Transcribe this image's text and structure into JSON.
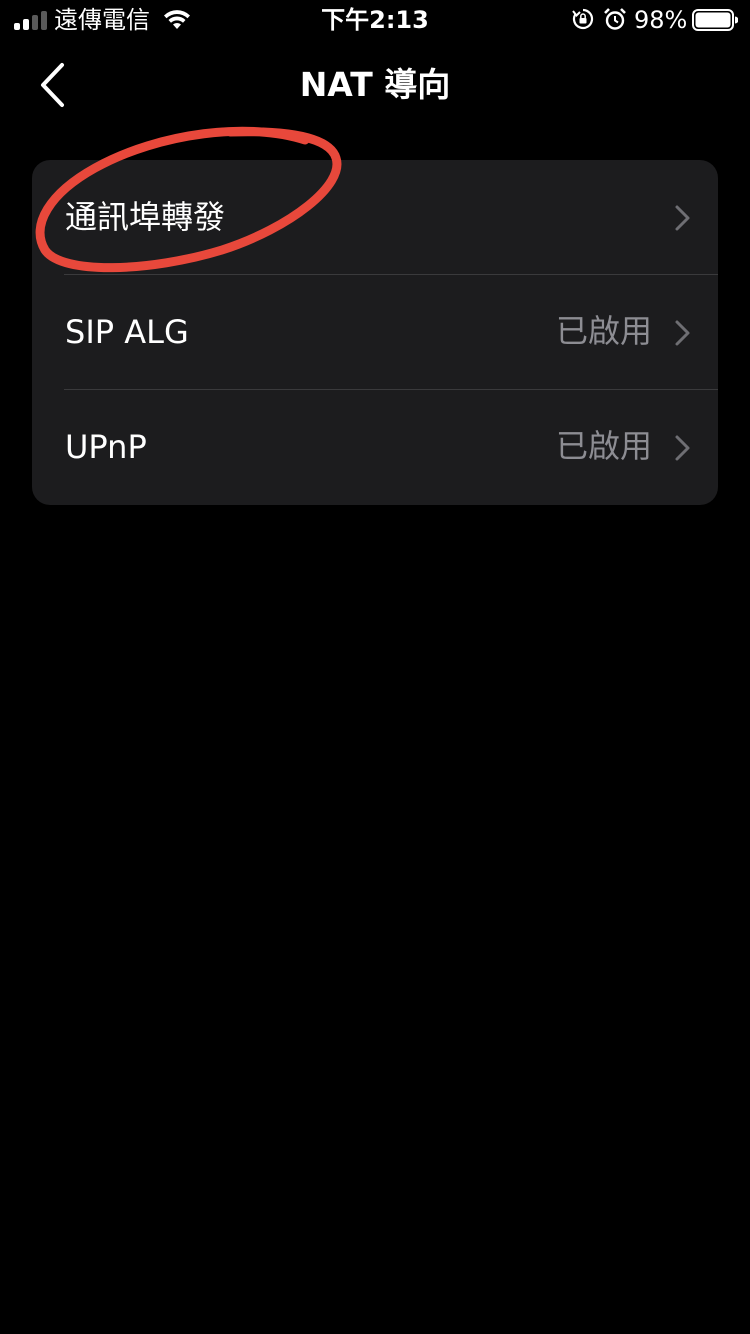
{
  "status_bar": {
    "carrier": "遠傳電信",
    "time": "下午2:13",
    "battery_percent": "98%",
    "icons": [
      "signal-icon",
      "wifi-icon",
      "rotation-lock-icon",
      "alarm-icon",
      "battery-icon"
    ],
    "battery_level": 0.98
  },
  "nav": {
    "title": "NAT 導向",
    "back_icon": "chevron-left-icon"
  },
  "settings": {
    "rows": [
      {
        "label": "通訊埠轉發",
        "value": ""
      },
      {
        "label": "SIP ALG",
        "value": "已啟用"
      },
      {
        "label": "UPnP",
        "value": "已啟用"
      }
    ]
  },
  "annotation": {
    "type": "hand-drawn circle",
    "color": "#e8483b"
  },
  "colors": {
    "background": "#000000",
    "cell_background": "#1c1c1e",
    "secondary_text": "#8d8d93",
    "separator": "#3a3a3c"
  }
}
